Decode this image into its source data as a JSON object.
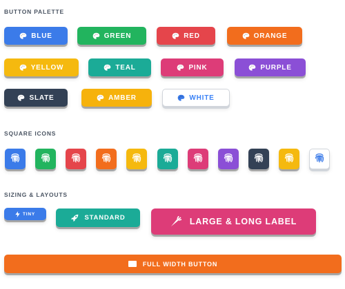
{
  "sections": {
    "palette_title": "BUTTON PALETTE",
    "square_title": "SQUARE ICONS",
    "sizing_title": "SIZING & LAYOUTS"
  },
  "palette": [
    {
      "label": "BLUE",
      "color": "#3b7be9",
      "icon": "palette-icon"
    },
    {
      "label": "GREEN",
      "color": "#22b45e",
      "icon": "palette-icon"
    },
    {
      "label": "RED",
      "color": "#e5454b",
      "icon": "palette-icon"
    },
    {
      "label": "ORANGE",
      "color": "#f26d1d",
      "icon": "palette-icon"
    },
    {
      "label": "YELLOW",
      "color": "#f5b90f",
      "icon": "palette-icon"
    },
    {
      "label": "TEAL",
      "color": "#1bab97",
      "icon": "palette-icon"
    },
    {
      "label": "PINK",
      "color": "#dd3c78",
      "icon": "palette-icon"
    },
    {
      "label": "PURPLE",
      "color": "#8b4fd6",
      "icon": "palette-icon"
    },
    {
      "label": "SLATE",
      "color": "#334155",
      "icon": "palette-icon"
    },
    {
      "label": "AMBER",
      "color": "#f6b20c",
      "icon": "palette-icon"
    },
    {
      "label": "WHITE",
      "color": "#ffffff",
      "text_color": "#3b7be9",
      "icon": "palette-icon"
    }
  ],
  "square_icons": [
    {
      "color": "#3b7be9",
      "icon": "fingerprint-icon"
    },
    {
      "color": "#22b45e",
      "icon": "fingerprint-icon"
    },
    {
      "color": "#e5454b",
      "icon": "fingerprint-icon"
    },
    {
      "color": "#f26d1d",
      "icon": "fingerprint-icon"
    },
    {
      "color": "#f5b90f",
      "icon": "fingerprint-icon"
    },
    {
      "color": "#1bab97",
      "icon": "fingerprint-icon"
    },
    {
      "color": "#dd3c78",
      "icon": "fingerprint-icon"
    },
    {
      "color": "#8b4fd6",
      "icon": "fingerprint-icon"
    },
    {
      "color": "#334155",
      "icon": "fingerprint-icon"
    },
    {
      "color": "#f5b90f",
      "icon": "fingerprint-icon"
    },
    {
      "color": "#ffffff",
      "icon": "fingerprint-icon"
    }
  ],
  "sizing": {
    "tiny": {
      "label": "TINY",
      "color": "#3b7be9",
      "icon": "bolt-icon"
    },
    "standard": {
      "label": "STANDARD",
      "color": "#1bab97",
      "icon": "rocket-icon"
    },
    "large": {
      "label": "LARGE & LONG LABEL",
      "color": "#dd3c78",
      "icon": "carrot-icon"
    },
    "full": {
      "label": "FULL WIDTH BUTTON",
      "color": "#f26d1d",
      "icon": "card-icon"
    }
  }
}
